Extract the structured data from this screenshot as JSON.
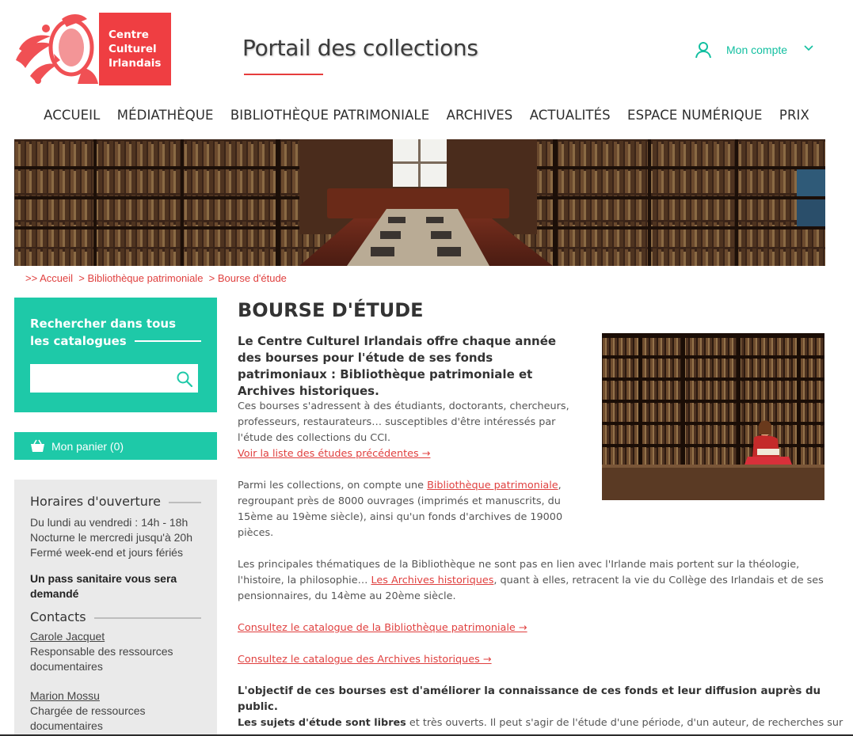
{
  "header": {
    "logo_lines": [
      "Centre",
      "Culturel",
      "Irlandais"
    ],
    "portal_title": "Portail des collections",
    "account_label": "Mon compte"
  },
  "nav": [
    "ACCUEIL",
    "MÉDIATHÈQUE",
    "BIBLIOTHÈQUE PATRIMONIALE",
    "ARCHIVES",
    "ACTUALITÉS",
    "ESPACE NUMÉRIQUE",
    "PRIX"
  ],
  "breadcrumb": {
    "prefix": ">> ",
    "items": [
      "Accueil",
      "> Bibliothèque patrimoniale",
      "> Bourse d'étude"
    ]
  },
  "sidebar": {
    "search_title_line1": "Rechercher dans tous",
    "search_title_line2": "les catalogues",
    "search_value": "",
    "cart_label": "Mon panier (0)",
    "hours_title": "Horaires d'ouverture",
    "hours_lines": [
      "Du lundi au vendredi : 14h - 18h",
      "Nocturne le mercredi jusqu'à 20h",
      "Fermé week-end et jours fériés"
    ],
    "pass_notice": "Un pass sanitaire vous sera demandé",
    "contacts_title": "Contacts",
    "contacts": [
      {
        "name": "Carole Jacquet",
        "role": "Responsable des ressources documentaires"
      },
      {
        "name": "Marion Mossu",
        "role": "Chargée de ressources documentaires"
      }
    ]
  },
  "main": {
    "title": "BOURSE D'ÉTUDE",
    "lead": "Le Centre Culturel Irlandais offre chaque année des bourses pour l'étude de ses fonds patrimoniaux : Bibliothèque patrimoniale et Archives historiques.",
    "p1_text": "Ces bourses s'adressent à des étudiants, doctorants, chercheurs, professeurs, restaurateurs… susceptibles d'être intéressés par l'étude des collections du CCI.",
    "p1_link": "Voir la liste des études précédentes →",
    "p2_before": "Parmi les collections, on compte une ",
    "p2_link": "Bibliothèque patrimoniale",
    "p2_after": ", regroupant près de 8000 ouvrages (imprimés et manuscrits, du 15ème au 19ème siècle), ainsi qu'un fonds d'archives de 19000 pièces.",
    "p3_before": "Les principales thématiques de la Bibliothèque ne sont pas en lien avec l'Irlande mais portent sur la théologie, l'histoire, la philosophie… ",
    "p3_link": "Les Archives historiques",
    "p3_after": ", quant à elles, retracent la vie du Collège des Irlandais et de ses pensionnaires, du 14ème au 20ème siècle.",
    "catalogue_biblio_link": "Consultez le catalogue de la Bibliothèque patrimoniale →",
    "catalogue_archives_link": "Consultez le catalogue des Archives historiques →",
    "objective": "L'objectif de ces bourses est d'améliorer la connaissance de ces fonds et leur diffusion auprès du public.",
    "subjects_bold": "Les sujets d'étude sont libres",
    "subjects_rest": " et très ouverts. Il peut s'agir de l'étude d'une période, d'un auteur, de recherches sur"
  },
  "colors": {
    "accent_red": "#ef3e42",
    "teal": "#1ec9a8",
    "sidebar_grey": "#eaeaea"
  },
  "icons": [
    "crest-logo-icon",
    "user-icon",
    "chevron-down-icon",
    "search-icon",
    "basket-icon"
  ]
}
